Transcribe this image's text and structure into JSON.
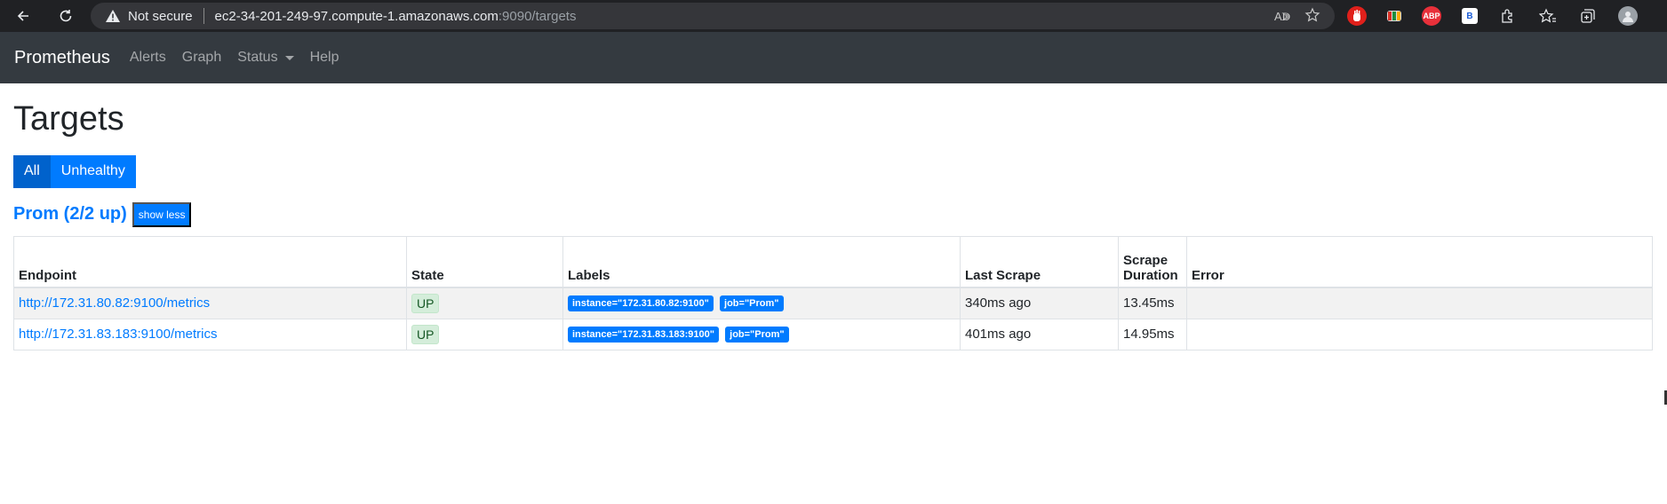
{
  "browser": {
    "not_secure": "Not secure",
    "host": "ec2-34-201-249-97.compute-1.amazonaws.com",
    "path": ":9090/targets",
    "ext_abp": "ABP",
    "ext_b": "B"
  },
  "navbar": {
    "brand": "Prometheus",
    "items": [
      "Alerts",
      "Graph",
      "Status",
      "Help"
    ]
  },
  "page": {
    "title": "Targets",
    "filter_all": "All",
    "filter_unhealthy": "Unhealthy"
  },
  "job": {
    "title": "Prom (2/2 up)",
    "toggle_label": "show less"
  },
  "table": {
    "headers": {
      "endpoint": "Endpoint",
      "state": "State",
      "labels": "Labels",
      "last_scrape": "Last Scrape",
      "scrape_duration_1": "Scrape",
      "scrape_duration_2": "Duration",
      "error": "Error"
    },
    "rows": [
      {
        "endpoint": "http://172.31.80.82:9100/metrics",
        "state": "UP",
        "label_instance": "instance=\"172.31.80.82:9100\"",
        "label_job": "job=\"Prom\"",
        "last_scrape": "340ms ago",
        "duration": "13.45ms",
        "error": ""
      },
      {
        "endpoint": "http://172.31.83.183:9100/metrics",
        "state": "UP",
        "label_instance": "instance=\"172.31.83.183:9100\"",
        "label_job": "job=\"Prom\"",
        "last_scrape": "401ms ago",
        "duration": "14.95ms",
        "error": ""
      }
    ]
  },
  "colors": {
    "primary": "#007bff",
    "navbar": "#343a40",
    "up_badge": "#d4edda"
  }
}
